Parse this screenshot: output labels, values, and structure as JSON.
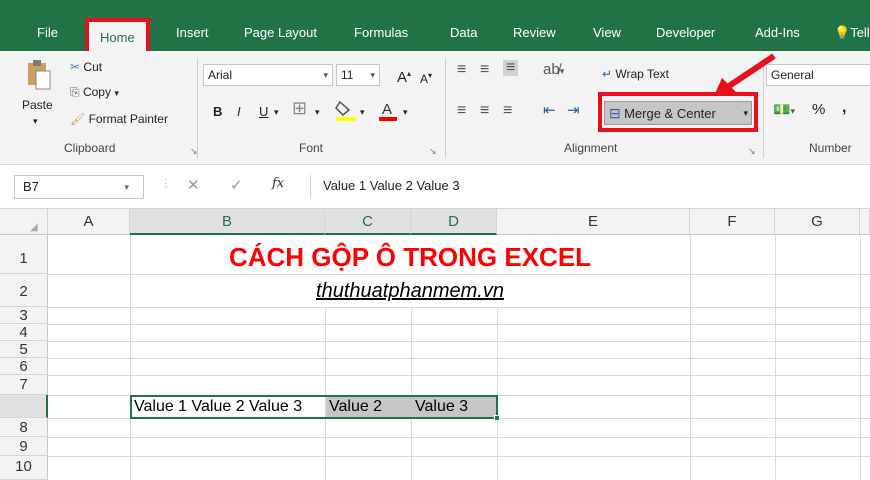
{
  "tabs": [
    "File",
    "Home",
    "Insert",
    "Page Layout",
    "Formulas",
    "Data",
    "Review",
    "View",
    "Developer",
    "Add-Ins",
    "Tell me"
  ],
  "clipboard": {
    "paste": "Paste",
    "cut": "Cut",
    "copy": "Copy",
    "format_painter": "Format Painter",
    "group": "Clipboard"
  },
  "font": {
    "name": "Arial",
    "size": "11",
    "bold": "B",
    "italic": "I",
    "underline": "U",
    "grow": "A",
    "shrink": "A",
    "color": "A",
    "group": "Font"
  },
  "alignment": {
    "wrap_text": "Wrap Text",
    "merge_center": "Merge & Center",
    "group": "Alignment"
  },
  "number": {
    "format": "General",
    "percent": "%",
    "comma": ",",
    "group": "Number"
  },
  "formula_bar": {
    "name_box": "B7",
    "fx": "fx",
    "content": "Value 1 Value 2 Value 3"
  },
  "columns": [
    "A",
    "B",
    "C",
    "D",
    "E",
    "F",
    "G"
  ],
  "rows": [
    "1",
    "2",
    "3",
    "4",
    "5",
    "6",
    "7",
    "8",
    "9",
    "10"
  ],
  "cells": {
    "title": "CÁCH GỘP Ô TRONG EXCEL",
    "subtitle": "thuthuatphanmem.vn",
    "b7": "Value 1 Value 2 Value 3",
    "c7": "Value 2",
    "d7": "Value 3"
  },
  "colors": {
    "excel_green": "#217346",
    "highlight_red": "#e8101b",
    "title_red": "#ff0000"
  }
}
